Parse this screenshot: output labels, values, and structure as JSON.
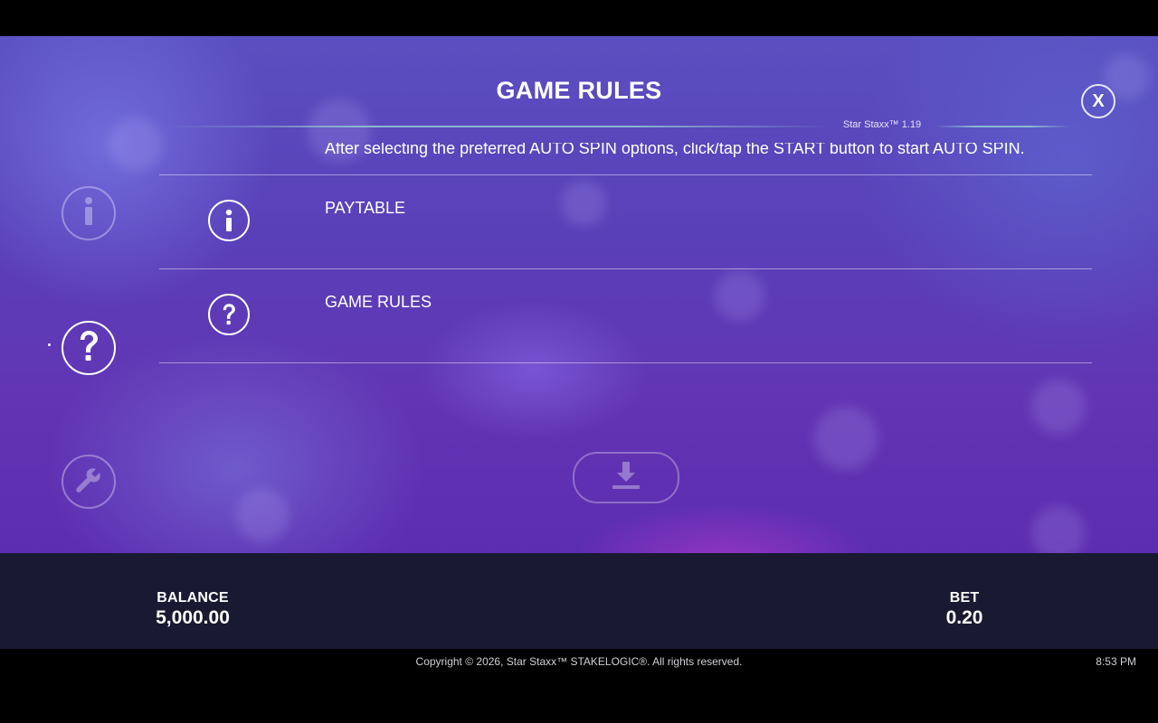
{
  "header": {
    "title": "GAME RULES",
    "version": "Star Staxx™ 1.19",
    "close_label": "X"
  },
  "sidebar": {
    "items": [
      {
        "name": "paytable",
        "icon": "info-icon",
        "active": false
      },
      {
        "name": "game-rules",
        "icon": "question-icon",
        "active": true
      },
      {
        "name": "settings",
        "icon": "wrench-icon",
        "active": false
      }
    ]
  },
  "content": {
    "partial_text": "After selecting the preferred AUTO SPIN options, click/tap the START button to start AUTO SPIN.",
    "rows": [
      {
        "label": "PAYTABLE",
        "icon": "info-icon"
      },
      {
        "label": "GAME RULES",
        "icon": "question-icon"
      }
    ],
    "download_icon": "download-icon"
  },
  "status": {
    "balance_label": "BALANCE",
    "balance_value": "5,000.00",
    "bet_label": "BET",
    "bet_value": "0.20"
  },
  "footer": {
    "copyright": "Copyright © 2026, Star Staxx™ STAKELOGIC®. All rights reserved.",
    "time": "8:53 PM"
  },
  "colors": {
    "background": "#5a3fb8",
    "bottom_bar": "#1a1932",
    "accent_line": "#96d2d2"
  }
}
